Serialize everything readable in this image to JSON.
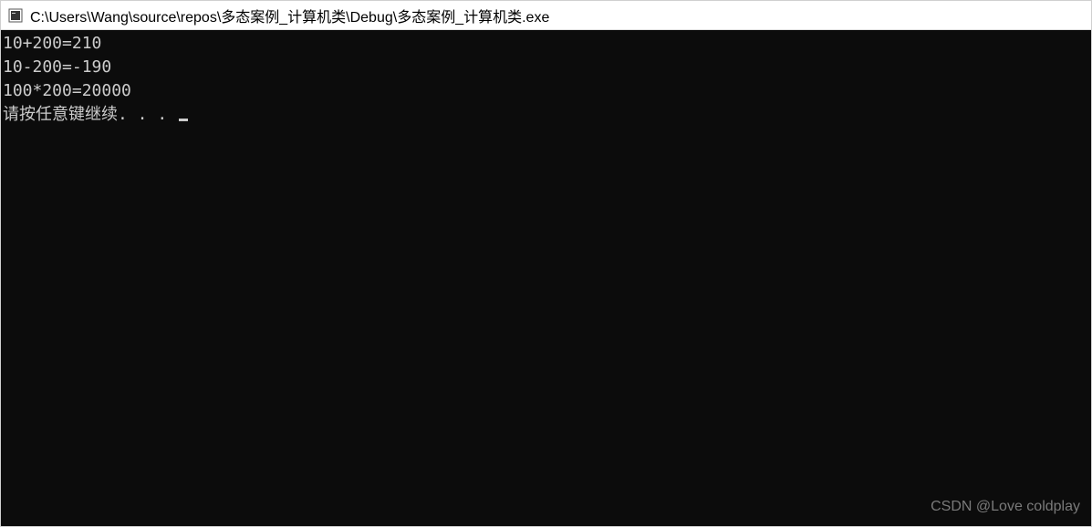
{
  "window": {
    "title": "C:\\Users\\Wang\\source\\repos\\多态案例_计算机类\\Debug\\多态案例_计算机类.exe"
  },
  "console": {
    "lines": [
      "10+200=210",
      "10-200=-190",
      "100*200=20000",
      "请按任意键继续. . . "
    ]
  },
  "watermark": "CSDN @Love coldplay"
}
